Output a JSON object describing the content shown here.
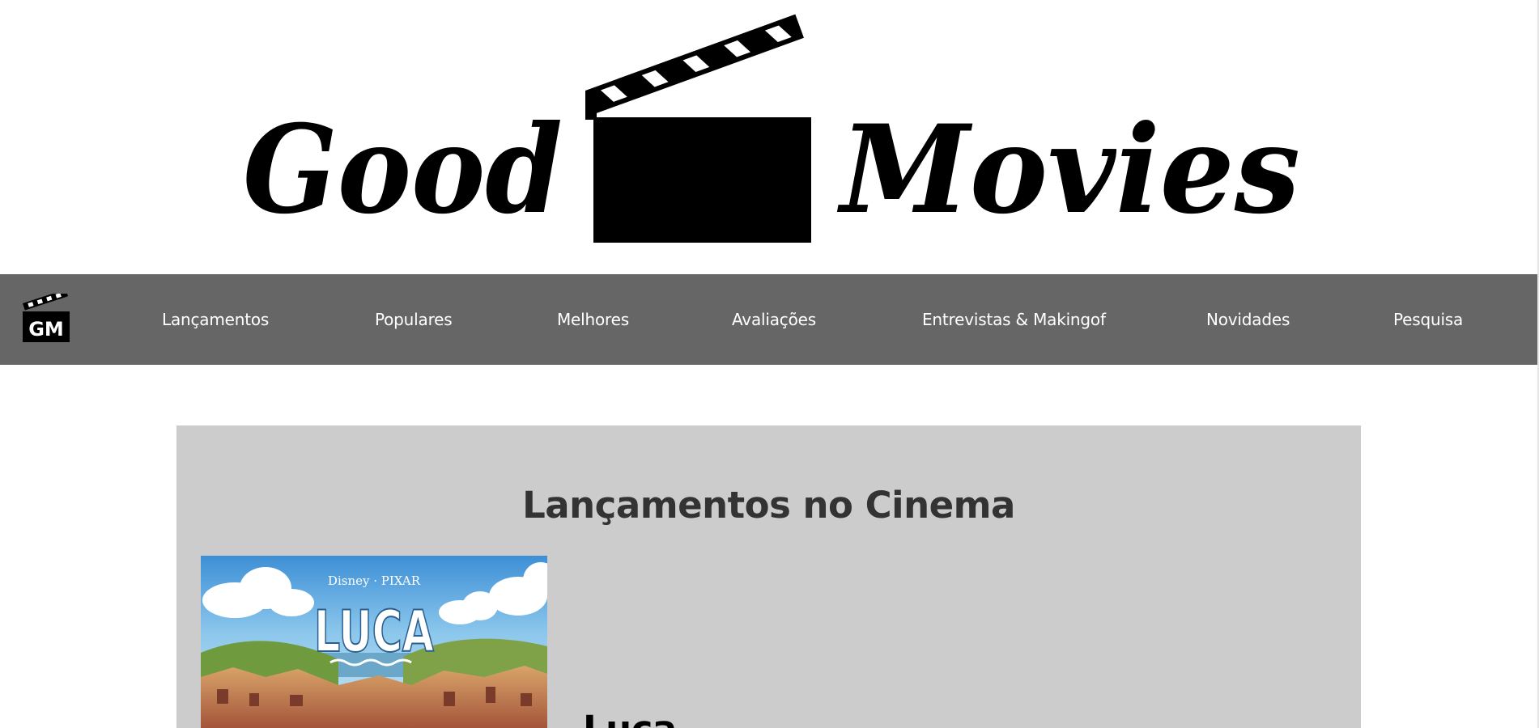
{
  "brand": {
    "logo_word_left": "Good",
    "logo_word_right": "Movies",
    "nav_logo_text": "GM"
  },
  "nav": {
    "items": [
      {
        "label": "Lançamentos"
      },
      {
        "label": "Populares"
      },
      {
        "label": "Melhores"
      },
      {
        "label": "Avaliações"
      },
      {
        "label": "Entrevistas & Makingof"
      },
      {
        "label": "Novidades"
      },
      {
        "label": "Pesquisa"
      }
    ]
  },
  "section": {
    "title": "Lançamentos no Cinema"
  },
  "movies": [
    {
      "title": "Luca",
      "poster_brand": "Disney · PIXAR",
      "poster_title": "LUCA"
    }
  ],
  "colors": {
    "navbar": "#666666",
    "panel": "#cccccc",
    "title_text": "#333333"
  }
}
